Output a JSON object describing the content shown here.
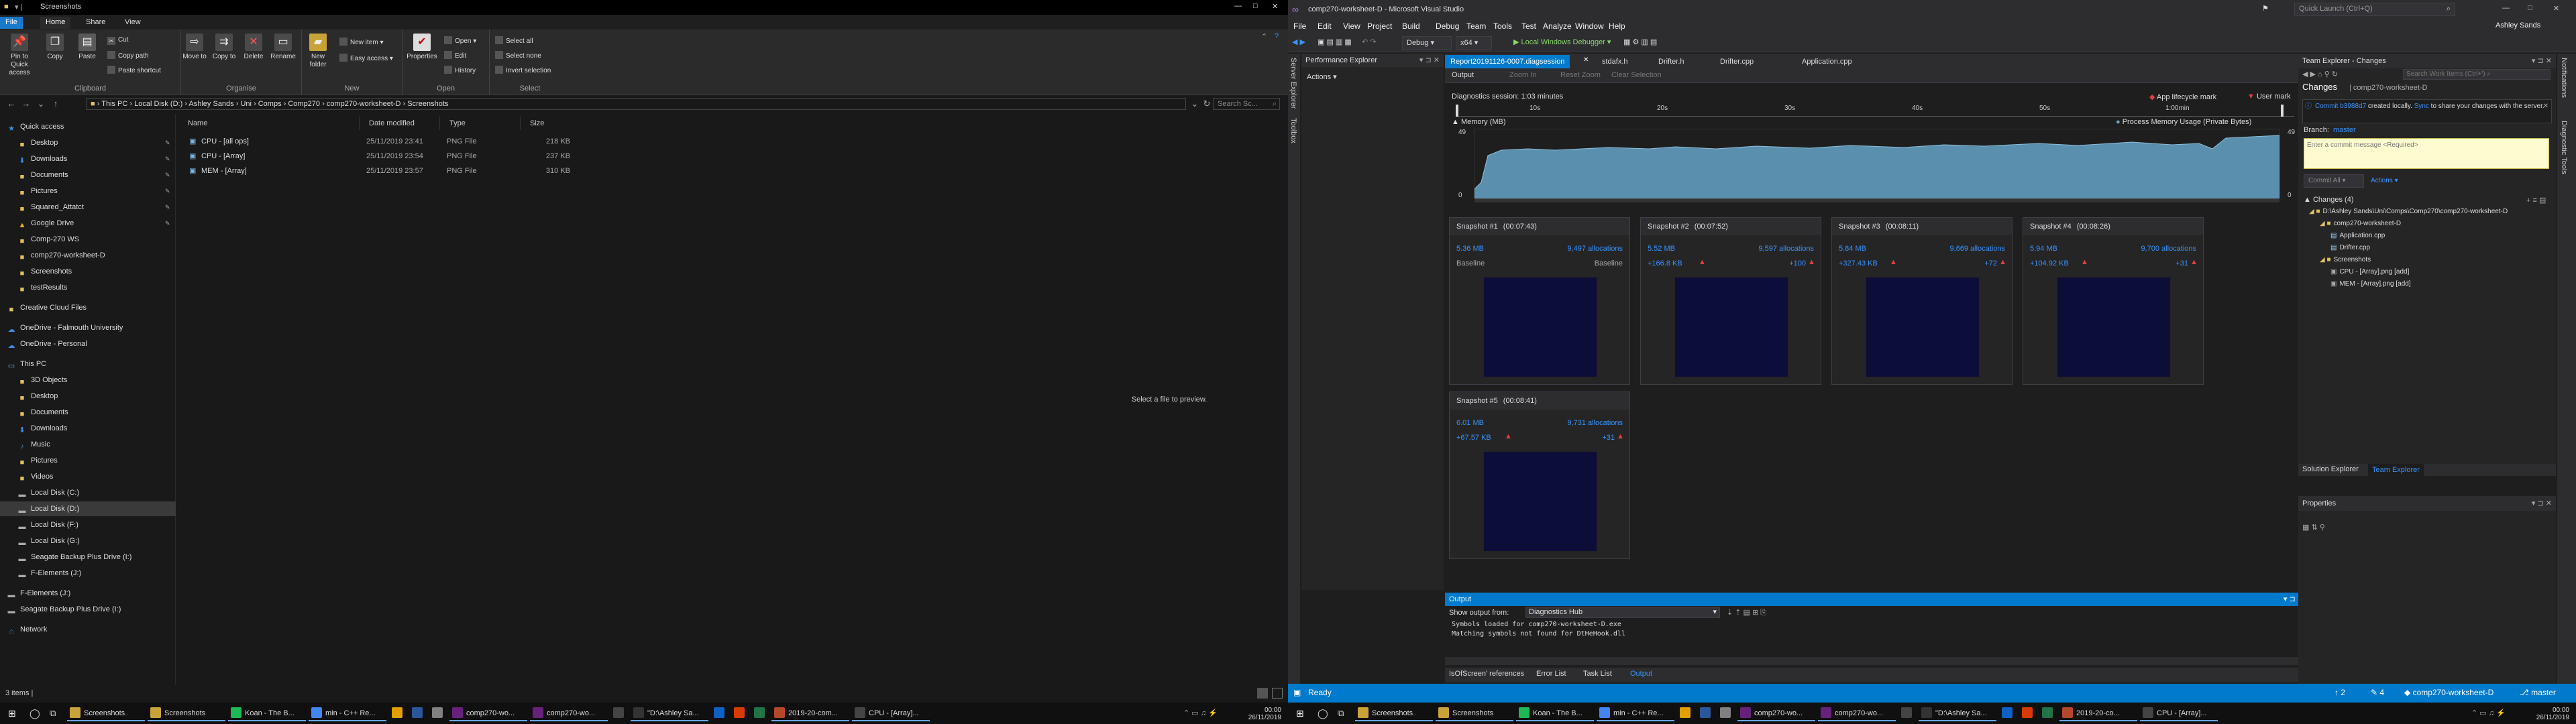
{
  "explorer": {
    "title": "Screenshots",
    "menu_tabs": [
      "File",
      "Home",
      "Share",
      "View"
    ],
    "ribbon": {
      "clipboard": {
        "title": "Clipboard",
        "pin_label": "Pin to Quick access",
        "copy_label": "Copy",
        "paste_label": "Paste",
        "cut_label": "Cut",
        "copy_path_label": "Copy path",
        "paste_shortcut_label": "Paste shortcut"
      },
      "organise": {
        "title": "Organise",
        "move_label": "Move to",
        "copy_label": "Copy to",
        "delete_label": "Delete",
        "rename_label": "Rename"
      },
      "new": {
        "title": "New",
        "new_folder_label": "New folder",
        "new_item_label": "New item ▾",
        "easy_access_label": "Easy access ▾"
      },
      "open": {
        "title": "Open",
        "properties_label": "Properties",
        "open_label": "Open ▾",
        "edit_label": "Edit",
        "history_label": "History"
      },
      "select": {
        "title": "Select",
        "select_all_label": "Select all",
        "select_none_label": "Select none",
        "invert_label": "Invert selection"
      }
    },
    "address": {
      "path": "›  This PC  ›  Local Disk (D:)  ›  Ashley Sands  ›  Uni  ›  Comps  ›  Comp270  ›  comp270-worksheet-D  ›  Screenshots",
      "search_placeholder": "Search Sc..."
    },
    "nav": [
      {
        "label": "Quick access",
        "icon": "star",
        "indent": 0
      },
      {
        "label": "Desktop",
        "icon": "folder",
        "indent": 1,
        "pinned": true
      },
      {
        "label": "Downloads",
        "icon": "download",
        "indent": 1,
        "pinned": true
      },
      {
        "label": "Documents",
        "icon": "folder",
        "indent": 1,
        "pinned": true
      },
      {
        "label": "Pictures",
        "icon": "folder",
        "indent": 1,
        "pinned": true
      },
      {
        "label": "Squared_Attatct",
        "icon": "folder",
        "indent": 1,
        "pinned": true
      },
      {
        "label": "Google Drive",
        "icon": "drive",
        "indent": 1,
        "pinned": true
      },
      {
        "label": "Comp-270 WS",
        "icon": "folder",
        "indent": 1
      },
      {
        "label": "comp270-worksheet-D",
        "icon": "folder",
        "indent": 1
      },
      {
        "label": "Screenshots",
        "icon": "folder",
        "indent": 1
      },
      {
        "label": "testResults",
        "icon": "folder",
        "indent": 1
      },
      {
        "label": "Creative Cloud Files",
        "icon": "folder",
        "indent": 0
      },
      {
        "label": "OneDrive - Falmouth University",
        "icon": "cloud",
        "indent": 0
      },
      {
        "label": "OneDrive - Personal",
        "icon": "cloud",
        "indent": 0
      },
      {
        "label": "This PC",
        "icon": "pc",
        "indent": 0
      },
      {
        "label": "3D Objects",
        "icon": "folder",
        "indent": 1
      },
      {
        "label": "Desktop",
        "icon": "folder",
        "indent": 1
      },
      {
        "label": "Documents",
        "icon": "folder",
        "indent": 1
      },
      {
        "label": "Downloads",
        "icon": "download",
        "indent": 1
      },
      {
        "label": "Music",
        "icon": "music",
        "indent": 1
      },
      {
        "label": "Pictures",
        "icon": "folder",
        "indent": 1
      },
      {
        "label": "Videos",
        "icon": "folder",
        "indent": 1
      },
      {
        "label": "Local Disk (C:)",
        "icon": "disk",
        "indent": 1
      },
      {
        "label": "Local Disk (D:)",
        "icon": "disk",
        "indent": 1,
        "selected": true
      },
      {
        "label": "Local Disk (F:)",
        "icon": "disk",
        "indent": 1
      },
      {
        "label": "Local Disk (G:)",
        "icon": "disk",
        "indent": 1
      },
      {
        "label": "Seagate Backup Plus Drive (I:)",
        "icon": "disk",
        "indent": 1
      },
      {
        "label": "F-Elements (J:)",
        "icon": "disk",
        "indent": 1
      },
      {
        "label": "F-Elements (J:)",
        "icon": "disk",
        "indent": 0
      },
      {
        "label": "Seagate Backup Plus Drive (I:)",
        "icon": "disk",
        "indent": 0
      },
      {
        "label": "Network",
        "icon": "network",
        "indent": 0
      }
    ],
    "columns": [
      "Name",
      "Date modified",
      "Type",
      "Size"
    ],
    "files": [
      {
        "name": "CPU - [all ops]",
        "date": "25/11/2019 23:41",
        "type": "PNG File",
        "size": "218 KB"
      },
      {
        "name": "CPU - [Array]",
        "date": "25/11/2019 23:54",
        "type": "PNG File",
        "size": "237 KB"
      },
      {
        "name": "MEM - [Array]",
        "date": "25/11/2019 23:57",
        "type": "PNG File",
        "size": "310 KB"
      }
    ],
    "preview_text": "Select a file to preview.",
    "status_text": "3 items  |"
  },
  "vs": {
    "title": "comp270-worksheet-D - Microsoft Visual Studio",
    "quick_launch": "Quick Launch (Ctrl+Q)",
    "user": "Ashley Sands",
    "menu": [
      "File",
      "Edit",
      "View",
      "Project",
      "Build",
      "Debug",
      "Team",
      "Tools",
      "Test",
      "Analyze",
      "Window",
      "Help"
    ],
    "toolbar": {
      "config": "Debug",
      "platform": "x64",
      "debugger": "▶ Local Windows Debugger ▾"
    },
    "left_vertical_tabs": [
      "Server Explorer",
      "Toolbox"
    ],
    "perf_explorer": {
      "title": "Performance Explorer",
      "actions": "Actions ▾"
    },
    "doc_tabs": [
      "Report20191126-0007.diagsession",
      "stdafx.h",
      "Drifter.h",
      "Drifter.cpp",
      "Application.cpp"
    ],
    "diag_toolbar": [
      "Output",
      "Zoom In",
      "Reset Zoom",
      "Clear Selection"
    ],
    "session_label": "Diagnostics session: 1:03 minutes",
    "markers": [
      "App lifecycle mark",
      "User mark"
    ],
    "ruler_ticks": [
      "10s",
      "20s",
      "30s",
      "40s",
      "50s",
      "1:00min"
    ],
    "memory": {
      "title": "Memory (MB)",
      "legend": "Process Memory Usage (Private Bytes)",
      "ymax": "49",
      "ymin": "0"
    },
    "snapshots": [
      {
        "label": "Snapshot #1",
        "time": "(00:07:43)",
        "size": "5.36 MB",
        "allocs": "9,497 allocations",
        "dsize": "Baseline",
        "dallocs": "Baseline"
      },
      {
        "label": "Snapshot #2",
        "time": "(00:07:52)",
        "size": "5.52 MB",
        "allocs": "9,597 allocations",
        "dsize": "+166.8 KB",
        "dallocs": "+100"
      },
      {
        "label": "Snapshot #3",
        "time": "(00:08:11)",
        "size": "5.84 MB",
        "allocs": "9,669 allocations",
        "dsize": "+327.43 KB",
        "dallocs": "+72"
      },
      {
        "label": "Snapshot #4",
        "time": "(00:08:26)",
        "size": "5.94 MB",
        "allocs": "9,700 allocations",
        "dsize": "+104.92 KB",
        "dallocs": "+31"
      },
      {
        "label": "Snapshot #5",
        "time": "(00:08:41)",
        "size": "6.01 MB",
        "allocs": "9,731 allocations",
        "dsize": "+67.57 KB",
        "dallocs": "+31"
      }
    ],
    "output": {
      "title": "Output",
      "show_from_label": "Show output from:",
      "source": "Diagnostics Hub",
      "lines": [
        "Symbols loaded for comp270-worksheet-D.exe",
        "Matching symbols not found for DtHeHook.dll"
      ],
      "tabs": [
        "IsOfScreen' references",
        "Error List",
        "Task List",
        "Output"
      ]
    },
    "team_explorer": {
      "title": "Team Explorer - Changes",
      "page": "Changes",
      "repo": "comp270-worksheet-D",
      "notice_commit": "Commit b3988d7",
      "notice_rest": " created locally. ",
      "notice_link": "Sync",
      "notice_tail": " to share your changes with the server.",
      "branch_label": "Branch:",
      "branch": "master",
      "commit_placeholder": "Enter a commit message <Required>",
      "commit_all": "Commit All ▾",
      "actions": "Actions ▾",
      "changes_header": "Changes (4)",
      "tree": [
        "D:\\Ashley Sands\\Uni\\Comps\\Comp270\\comp270-worksheet-D",
        "comp270-worksheet-D",
        "Application.cpp",
        "Drifter.cpp",
        "Screenshots",
        "CPU - [Array].png [add]",
        "MEM - [Array].png [add]"
      ],
      "bottom_tabs": [
        "Solution Explorer",
        "Team Explorer"
      ]
    },
    "properties_title": "Properties",
    "right_vertical_tabs": [
      "Notifications",
      "Diagnostic Tools"
    ],
    "status": {
      "ready": "Ready",
      "up": "↑ 2",
      "pencil": "✎ 4",
      "repo": "◆ comp270-worksheet-D",
      "branch": "⎇ master"
    }
  },
  "taskbar_left": {
    "items": [
      "Screenshots",
      "Screenshots",
      "Koan - The B...",
      "min - C++ Re...",
      "",
      "",
      "",
      "comp270-wo...",
      "comp270-wo...",
      "",
      "\"D:\\Ashley Sa...",
      "",
      "",
      "",
      "2019-20-com...",
      "CPU - [Array]..."
    ],
    "time": "00:00",
    "date": "26/11/2019"
  },
  "taskbar_right": {
    "items": [
      "Screenshots",
      "Screenshots",
      "Koan - The B...",
      "min - C++ Re...",
      "",
      "",
      "",
      "comp270-wo...",
      "comp270-wo...",
      "",
      "\"D:\\Ashley Sa...",
      "",
      "",
      "",
      "2019-20-co...",
      "CPU - [Array]..."
    ],
    "time": "00:00",
    "date": "26/11/2019"
  }
}
